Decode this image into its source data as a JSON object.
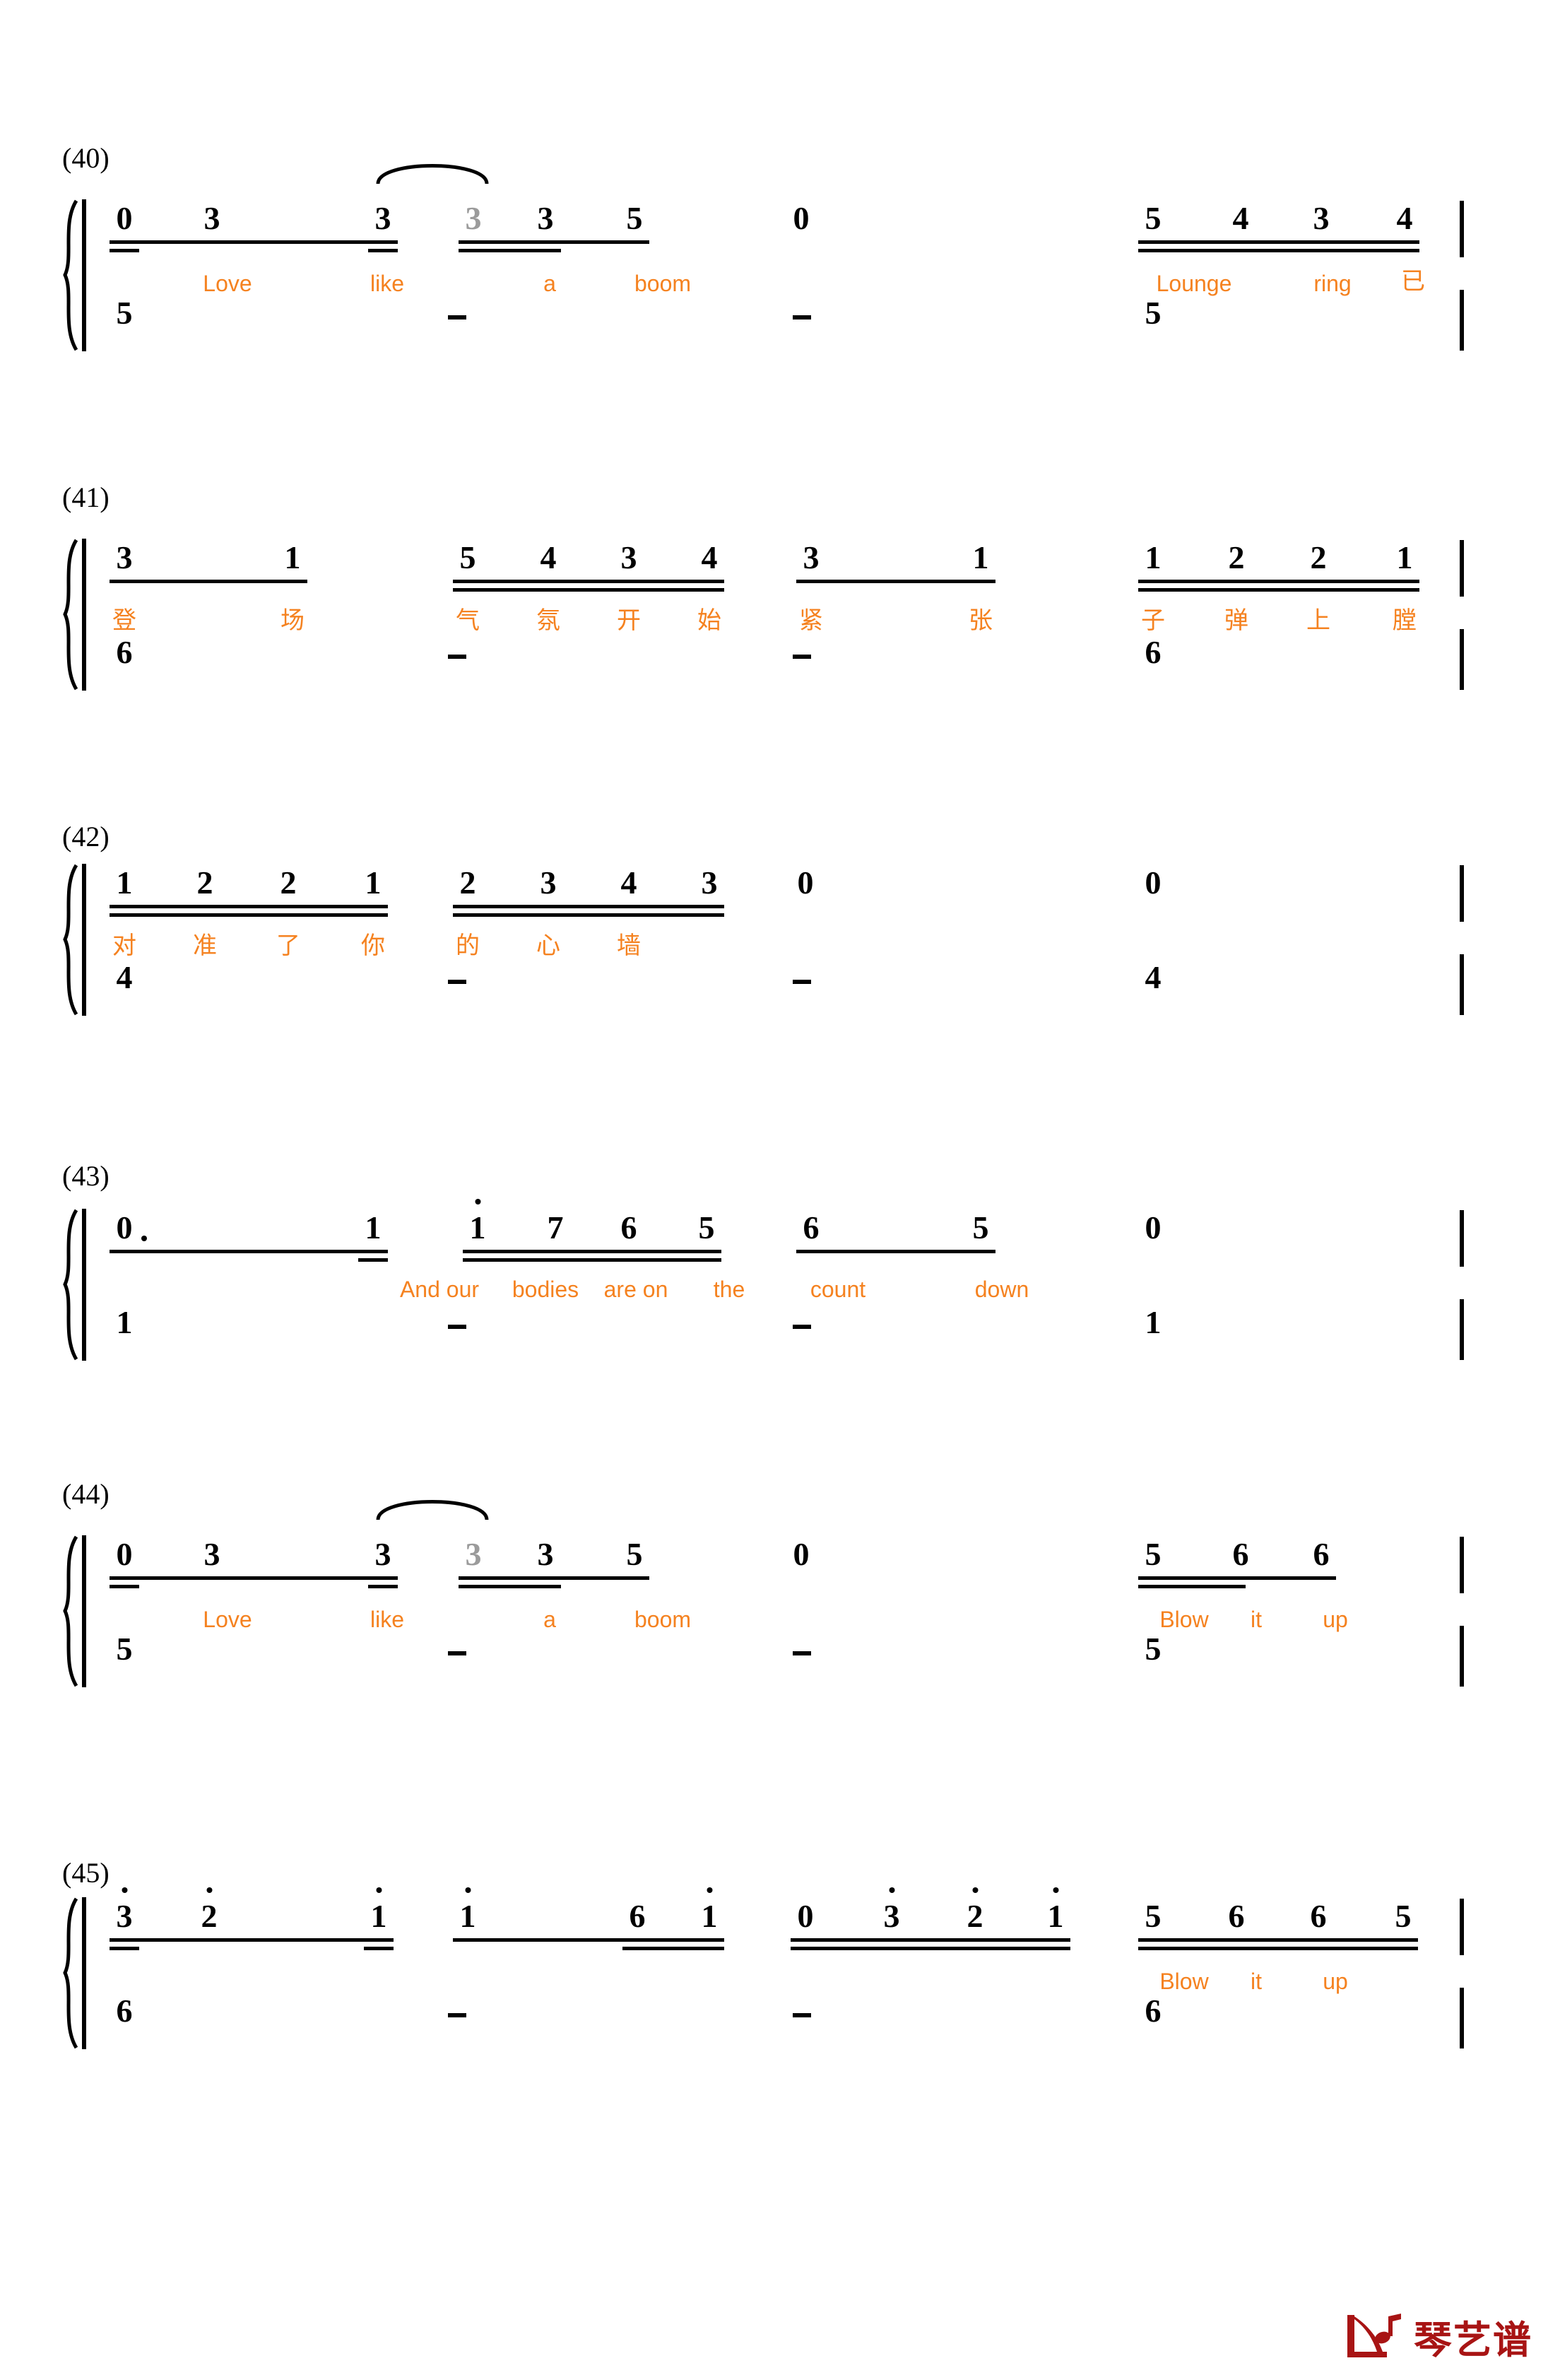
{
  "document": {
    "notation_type": "jianpu",
    "lyric_color": "#F58220",
    "note_color": "#000000",
    "tied_note_color": "#9B9B9B",
    "logo_color": "#A81414",
    "logo_text": "琴艺谱",
    "logo_icon": "piano-note-icon"
  },
  "systems": [
    {
      "measure_label": "(40)",
      "groups": [
        {
          "beams": 1,
          "notes": [
            {
              "value": "0",
              "octave": 0,
              "beams_under": 1
            },
            {
              "value": "3",
              "octave": 0,
              "beams_under": 0
            },
            {
              "value": "3",
              "octave": 0,
              "beams_under": 1
            }
          ],
          "lyrics": [
            "Love",
            "like"
          ]
        },
        {
          "beams": 2,
          "notes": [
            {
              "value": "3",
              "octave": 0,
              "tied": true
            },
            {
              "value": "3",
              "octave": 0
            },
            {
              "value": "5",
              "octave": 0
            }
          ],
          "lyrics": [
            "a",
            "boom"
          ]
        },
        {
          "beams": 0,
          "notes": [
            {
              "value": "0",
              "octave": 0
            }
          ],
          "lyrics": []
        },
        {
          "beams": 2,
          "notes": [
            {
              "value": "5",
              "octave": 0
            },
            {
              "value": "4",
              "octave": 0
            },
            {
              "value": "3",
              "octave": 0
            },
            {
              "value": "4",
              "octave": 0
            }
          ],
          "lyrics": [
            "Lounge",
            "ring",
            "已"
          ]
        }
      ],
      "slur": {
        "from_note": 3,
        "to_note": 4
      },
      "bass": [
        {
          "value": "5",
          "low_dots": 2
        },
        {
          "value": "-",
          "dash": true
        },
        {
          "value": "-",
          "dash": true
        },
        {
          "value": "5",
          "low_dots": 2
        }
      ]
    },
    {
      "measure_label": "(41)",
      "groups": [
        {
          "beams": 1,
          "notes": [
            {
              "value": "3",
              "octave": 0
            },
            {
              "value": "1",
              "octave": 0
            }
          ],
          "lyrics": [
            "登",
            "场"
          ]
        },
        {
          "beams": 2,
          "notes": [
            {
              "value": "5",
              "octave": 0
            },
            {
              "value": "4",
              "octave": 0
            },
            {
              "value": "3",
              "octave": 0
            },
            {
              "value": "4",
              "octave": 0
            }
          ],
          "lyrics": [
            "气",
            "氛",
            "开",
            "始"
          ]
        },
        {
          "beams": 1,
          "notes": [
            {
              "value": "3",
              "octave": 0
            },
            {
              "value": "1",
              "octave": 0
            }
          ],
          "lyrics": [
            "紧",
            "张"
          ]
        },
        {
          "beams": 2,
          "notes": [
            {
              "value": "1",
              "octave": 0
            },
            {
              "value": "2",
              "octave": 0
            },
            {
              "value": "2",
              "octave": 0
            },
            {
              "value": "1",
              "octave": 0
            }
          ],
          "lyrics": [
            "子",
            "弹",
            "上",
            "膛"
          ]
        }
      ],
      "bass": [
        {
          "value": "6",
          "low_dots": 2
        },
        {
          "value": "-",
          "dash": true
        },
        {
          "value": "-",
          "dash": true
        },
        {
          "value": "6",
          "low_dots": 2
        }
      ]
    },
    {
      "measure_label": "(42)",
      "groups": [
        {
          "beams": 2,
          "notes": [
            {
              "value": "1",
              "octave": 0
            },
            {
              "value": "2",
              "octave": 0
            },
            {
              "value": "2",
              "octave": 0
            },
            {
              "value": "1",
              "octave": 0
            }
          ],
          "lyrics": [
            "对",
            "准",
            "了",
            "你"
          ]
        },
        {
          "beams": 2,
          "notes": [
            {
              "value": "2",
              "octave": 0
            },
            {
              "value": "3",
              "octave": 0
            },
            {
              "value": "4",
              "octave": 0
            },
            {
              "value": "3",
              "octave": 0
            }
          ],
          "lyrics": [
            "的",
            "心",
            "墙"
          ]
        },
        {
          "beams": 0,
          "notes": [
            {
              "value": "0",
              "octave": 0
            }
          ],
          "lyrics": []
        },
        {
          "beams": 0,
          "notes": [
            {
              "value": "0",
              "octave": 0
            }
          ],
          "lyrics": []
        }
      ],
      "bass": [
        {
          "value": "4",
          "low_dots": 2
        },
        {
          "value": "-",
          "dash": true
        },
        {
          "value": "-",
          "dash": true
        },
        {
          "value": "4",
          "low_dots": 2
        }
      ]
    },
    {
      "measure_label": "(43)",
      "groups": [
        {
          "beams": 1,
          "notes": [
            {
              "value": "0",
              "octave": 0,
              "aug_dot": true
            },
            {
              "value": "1",
              "octave": 0
            }
          ],
          "lyrics": []
        },
        {
          "beams": 2,
          "notes": [
            {
              "value": "1",
              "octave": 1
            },
            {
              "value": "7",
              "octave": 0
            },
            {
              "value": "6",
              "octave": 0
            },
            {
              "value": "5",
              "octave": 0
            }
          ],
          "lyrics": [
            "And our",
            "bodies",
            "are on",
            "the"
          ]
        },
        {
          "beams": 1,
          "notes": [
            {
              "value": "6",
              "octave": 0
            },
            {
              "value": "5",
              "octave": 0
            }
          ],
          "lyrics": [
            "count",
            "down"
          ]
        },
        {
          "beams": 0,
          "notes": [
            {
              "value": "0",
              "octave": 0
            }
          ],
          "lyrics": []
        }
      ],
      "bass": [
        {
          "value": "1",
          "low_dots": 1
        },
        {
          "value": "-",
          "dash": true
        },
        {
          "value": "-",
          "dash": true
        },
        {
          "value": "1",
          "low_dots": 1
        }
      ]
    },
    {
      "measure_label": "(44)",
      "groups": [
        {
          "beams": 1,
          "notes": [
            {
              "value": "0",
              "octave": 0,
              "beams_under": 1
            },
            {
              "value": "3",
              "octave": 0
            },
            {
              "value": "3",
              "octave": 0,
              "beams_under": 1
            }
          ],
          "lyrics": [
            "Love",
            "like"
          ]
        },
        {
          "beams": 2,
          "notes": [
            {
              "value": "3",
              "octave": 0,
              "tied": true
            },
            {
              "value": "3",
              "octave": 0
            },
            {
              "value": "5",
              "octave": 0
            }
          ],
          "lyrics": [
            "a",
            "boom"
          ]
        },
        {
          "beams": 0,
          "notes": [
            {
              "value": "0",
              "octave": 0
            }
          ],
          "lyrics": []
        },
        {
          "beams": 2,
          "notes": [
            {
              "value": "5",
              "octave": 0
            },
            {
              "value": "6",
              "octave": 0
            },
            {
              "value": "6",
              "octave": 0
            }
          ],
          "lyrics": [
            "Blow",
            "it",
            "up"
          ]
        }
      ],
      "slur": {
        "from_note": 3,
        "to_note": 4
      },
      "bass": [
        {
          "value": "5",
          "low_dots": 2
        },
        {
          "value": "-",
          "dash": true
        },
        {
          "value": "-",
          "dash": true
        },
        {
          "value": "5",
          "low_dots": 2
        }
      ]
    },
    {
      "measure_label": "(45)",
      "groups": [
        {
          "beams": 2,
          "notes": [
            {
              "value": "3",
              "octave": 1
            },
            {
              "value": "2",
              "octave": 1
            },
            {
              "value": "1",
              "octave": 1
            }
          ],
          "lyrics": []
        },
        {
          "beams": 2,
          "notes": [
            {
              "value": "1",
              "octave": 1
            },
            {
              "value": "6",
              "octave": 0
            },
            {
              "value": "1",
              "octave": 1
            }
          ],
          "lyrics": []
        },
        {
          "beams": 2,
          "notes": [
            {
              "value": "0",
              "octave": 0
            },
            {
              "value": "3",
              "octave": 1
            },
            {
              "value": "2",
              "octave": 1
            },
            {
              "value": "1",
              "octave": 1
            }
          ],
          "lyrics": []
        },
        {
          "beams": 2,
          "notes": [
            {
              "value": "5",
              "octave": 0
            },
            {
              "value": "6",
              "octave": 0
            },
            {
              "value": "6",
              "octave": 0
            },
            {
              "value": "5",
              "octave": 0
            }
          ],
          "lyrics": [
            "Blow",
            "it",
            "up"
          ]
        }
      ],
      "bass": [
        {
          "value": "6",
          "low_dots": 2
        },
        {
          "value": "-",
          "dash": true
        },
        {
          "value": "-",
          "dash": true
        },
        {
          "value": "6",
          "low_dots": 2
        }
      ]
    }
  ]
}
